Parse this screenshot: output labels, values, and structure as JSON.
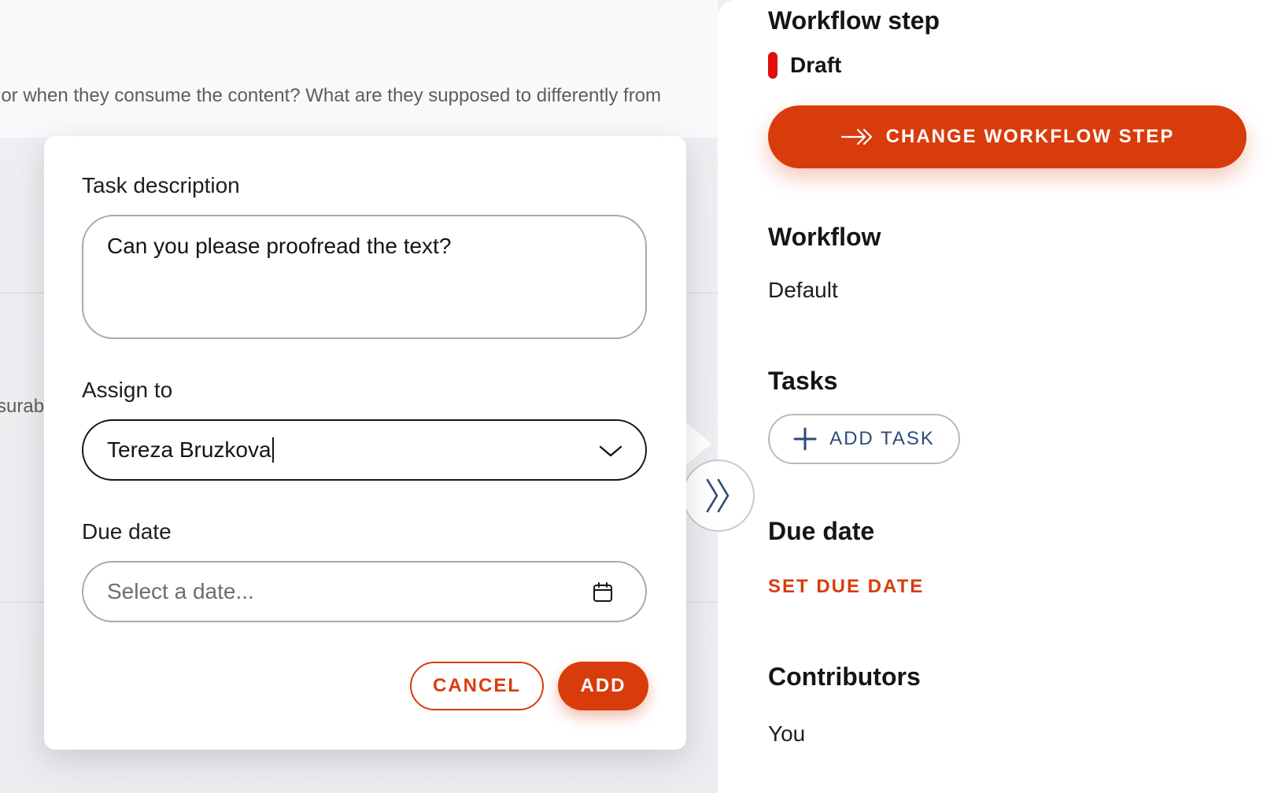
{
  "background": {
    "text_line_1": "ior when they consume the content? What are they supposed to differently from",
    "text_line_2": "surab"
  },
  "task_popup": {
    "description_label": "Task description",
    "description_value": "Can you please proofread the text?",
    "assign_label": "Assign to",
    "assign_value": "Tereza Bruzkova",
    "due_label": "Due date",
    "due_placeholder": "Select a date...",
    "cancel_label": "CANCEL",
    "add_label": "ADD"
  },
  "sidebar": {
    "workflow_step_heading": "Workflow step",
    "status_label": "Draft",
    "change_step_label": "CHANGE WORKFLOW STEP",
    "workflow_heading": "Workflow",
    "workflow_value": "Default",
    "tasks_heading": "Tasks",
    "add_task_label": "ADD TASK",
    "due_date_heading": "Due date",
    "set_due_date_label": "SET DUE DATE",
    "contributors_heading": "Contributors",
    "contributors_value": "You"
  },
  "colors": {
    "accent": "#d93c0c",
    "status_draft": "#e00d0d",
    "add_task_text": "#2e4a7a"
  },
  "icons": {
    "change_step": "arrow-right-double-chevron-icon",
    "collapse": "double-chevron-right-icon",
    "select": "chevron-down-icon",
    "date": "calendar-icon",
    "add_task": "plus-icon"
  }
}
